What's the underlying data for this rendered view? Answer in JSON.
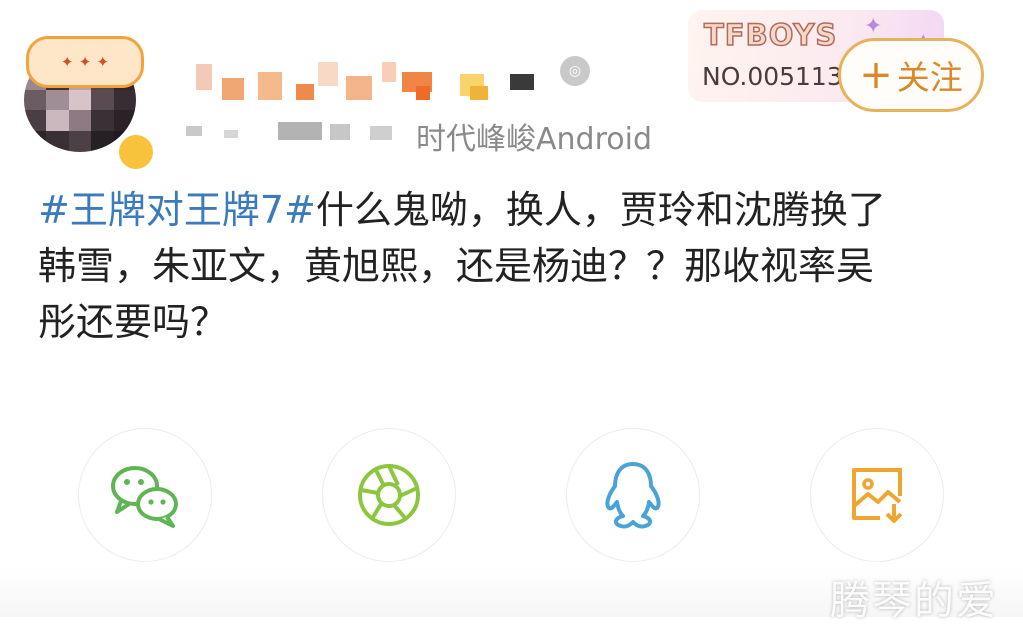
{
  "header": {
    "source_text": "时代峰峻Android",
    "card": {
      "title": "TFBOYS",
      "number": "NO.005113"
    },
    "follow_label": "关注"
  },
  "post": {
    "hashtag": "#王牌对王牌7#",
    "line1_rest": "什么鬼呦，换人，贾玲和沈腾换了",
    "line2": "韩雪，朱亚文，黄旭熙，还是杨迪？？那收视率吴",
    "line3": "彤还要吗？"
  },
  "share": {
    "items": [
      {
        "icon": "wechat-icon",
        "color": "#5fb554"
      },
      {
        "icon": "moments-shutter-icon",
        "color": "#8cc63f"
      },
      {
        "icon": "qq-penguin-icon",
        "color": "#4aa3d8"
      },
      {
        "icon": "save-image-icon",
        "color": "#f0a530"
      }
    ]
  },
  "colors": {
    "hashtag": "#3b7bbd",
    "follow_accent": "#e8b15c",
    "text": "#222222",
    "meta_text": "#8a8a8a"
  },
  "watermark": "腾琴的爱"
}
